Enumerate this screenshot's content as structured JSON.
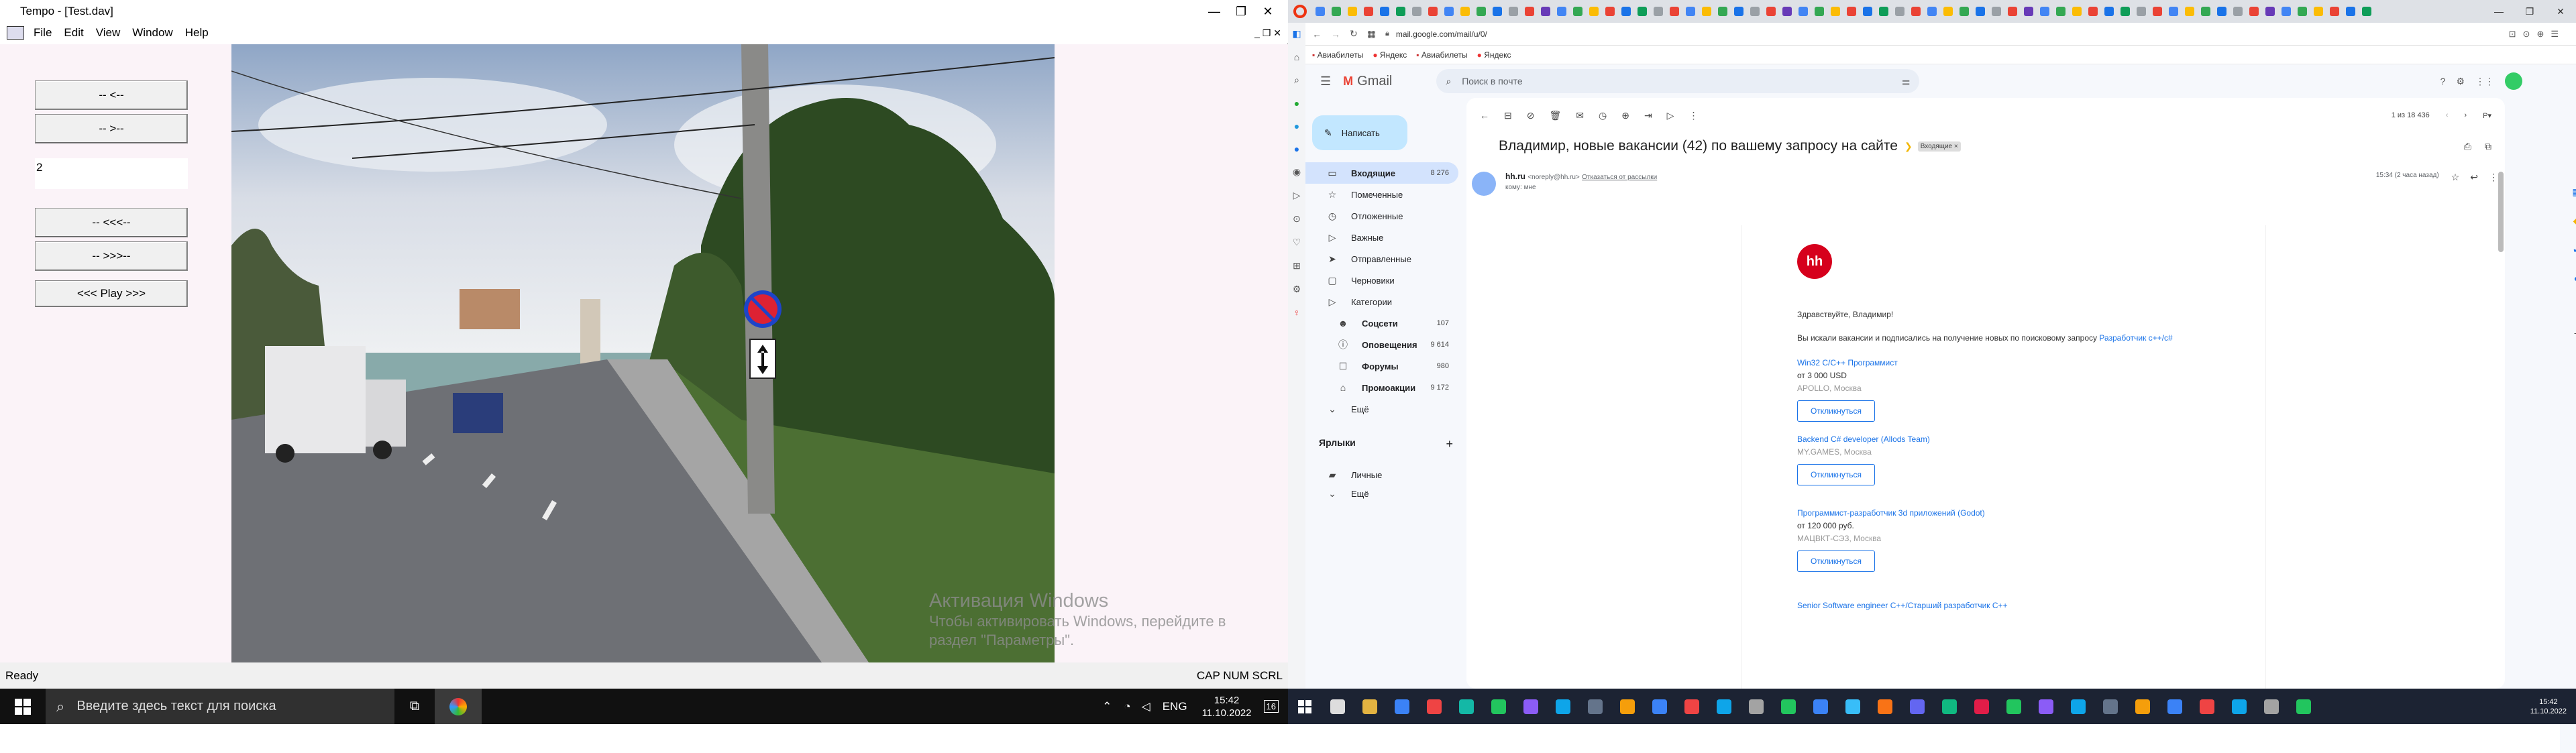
{
  "app": {
    "title": "Tempo - [Test.dav]",
    "menu": [
      "File",
      "Edit",
      "View",
      "Window",
      "Help"
    ],
    "buttons": {
      "prev": "-- <--",
      "next": "-- >--",
      "rewind": "-- <<<--",
      "forward": "-- >>>--",
      "play": "<<< Play >>>"
    },
    "frame_field": "2",
    "status_left": "Ready",
    "status_right": "CAP  NUM  SCRL",
    "watermark_title": "Активация Windows",
    "watermark_line1": "Чтобы активировать Windows, перейдите в",
    "watermark_line2": "раздел \"Параметры\"."
  },
  "taskbar_left": {
    "search_placeholder": "Введите здесь текст для поиска",
    "lang": "ENG",
    "time": "15:42",
    "date": "11.10.2022",
    "notif_count": "16"
  },
  "browser": {
    "url": "mail.google.com/mail/u/0/",
    "bookmarks": [
      "Авиабилеты",
      "Яндекс",
      "Авиабилеты",
      "Яндекс"
    ]
  },
  "gmail": {
    "logo": "Gmail",
    "search_placeholder": "Поиск в почте",
    "compose": "Написать",
    "nav": [
      {
        "icon": "inbox-icon",
        "label": "Входящие",
        "count": "8 276",
        "bold": true,
        "active": true
      },
      {
        "icon": "star-icon",
        "label": "Помеченные",
        "count": ""
      },
      {
        "icon": "clock-icon",
        "label": "Отложенные",
        "count": ""
      },
      {
        "icon": "important-icon",
        "label": "Важные",
        "count": ""
      },
      {
        "icon": "send-icon",
        "label": "Отправленные",
        "count": ""
      },
      {
        "icon": "draft-icon",
        "label": "Черновики",
        "count": ""
      },
      {
        "icon": "label-icon",
        "label": "Категории",
        "count": ""
      },
      {
        "icon": "people-icon",
        "label": "Соцсети",
        "count": "107",
        "bold": true
      },
      {
        "icon": "info-icon",
        "label": "Оповещения",
        "count": "9 614",
        "bold": true
      },
      {
        "icon": "forum-icon",
        "label": "Форумы",
        "count": "980",
        "bold": true
      },
      {
        "icon": "tag-icon",
        "label": "Промоакции",
        "count": "9 172",
        "bold": true
      },
      {
        "icon": "chevron-down-icon",
        "label": "Ещё",
        "count": ""
      }
    ],
    "labels_title": "Ярлыки",
    "labels": [
      "Личные",
      "Ещё"
    ],
    "pager": "1 из 18 436",
    "subject": "Владимир, новые вакансии (42) по вашему запросу на сайте",
    "inbox_chip": "Входящие ×",
    "sender_name": "hh.ru",
    "sender_email": "<noreply@hh.ru>",
    "unsubscribe": "Отказаться от рассылки",
    "to_me": "кому: мне",
    "time": "15:34 (2 часа назад)",
    "body": {
      "greeting": "Здравствуйте, Владимир!",
      "intro": "Вы искали вакансии и подписались на получение новых по поисковому запросу",
      "query": "Разработчик c++/c#",
      "apply": "Откликнуться",
      "jobs": [
        {
          "title": "Win32 C/C++ Программист",
          "salary": "от 3 000 USD",
          "company": "APOLLO, Москва"
        },
        {
          "title": "Backend C# developer (Allods Team)",
          "salary": "",
          "company": "MY.GAMES, Москва"
        },
        {
          "title": "Программист-разработчик 3d приложений (Godot)",
          "salary": "от 120 000 руб.",
          "company": "МАЦВКТ-СЭЗ, Москва"
        }
      ],
      "last_job": "Senior Software engineer C++/Старший разработчик C++"
    }
  },
  "taskbar_right": {
    "time": "15:42",
    "date": "11.10.2022"
  },
  "colors": {
    "gmail_active": "#d3e3fd",
    "link": "#1a73e8",
    "hh_red": "#d6001c",
    "taskbar": "#111111"
  }
}
